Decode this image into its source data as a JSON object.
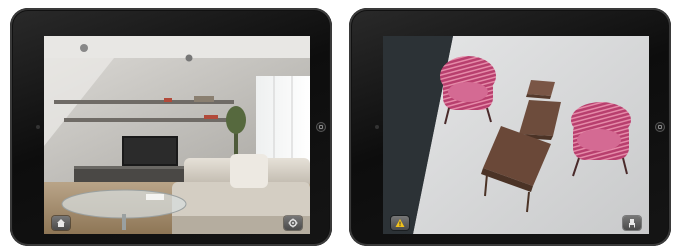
{
  "devices": [
    {
      "name": "living-room-view",
      "buttons": [
        {
          "icon": "home-icon"
        },
        {
          "icon": "settings-gear-icon"
        }
      ]
    },
    {
      "name": "ar-furniture-view",
      "buttons": [
        {
          "icon": "warning-icon"
        },
        {
          "icon": "chair-icon"
        }
      ]
    }
  ],
  "colors": {
    "bezel": "#111111",
    "wall": "#d8d6d2",
    "floor": "#a8906f",
    "table_surface": "#d9dadb",
    "armchair_stripe": "#c0487a",
    "coffee_table": "#6a4a3a",
    "warning": "#f2c21b"
  }
}
